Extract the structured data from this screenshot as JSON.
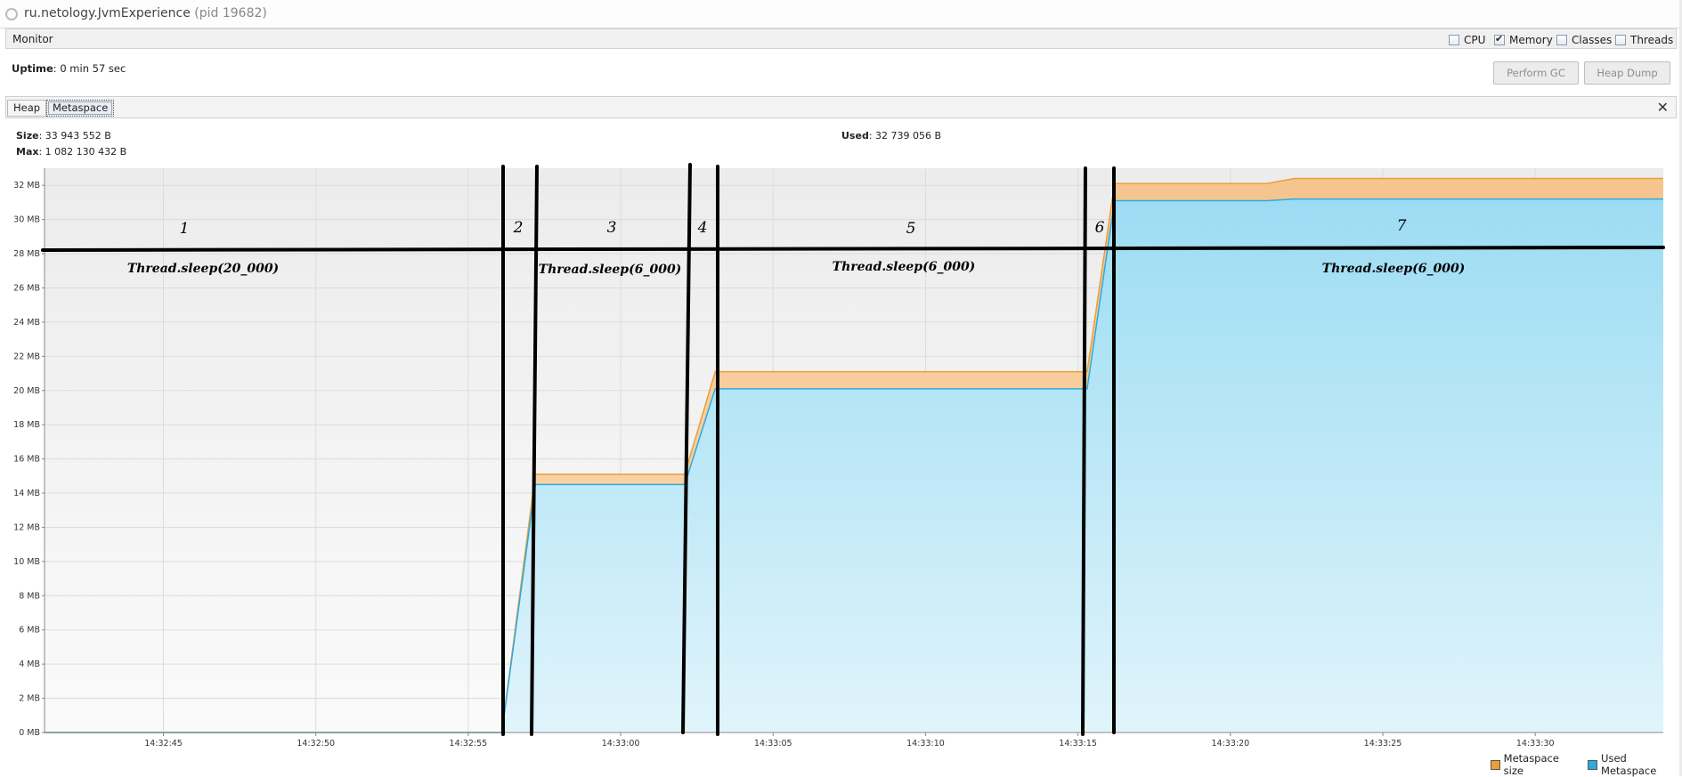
{
  "window": {
    "title": "ru.netology.JvmExperience",
    "pid": "(pid 19682)"
  },
  "monitor": {
    "label": "Monitor",
    "checkboxes": [
      {
        "label": "CPU",
        "checked": false
      },
      {
        "label": "Memory",
        "checked": true
      },
      {
        "label": "Classes",
        "checked": false
      },
      {
        "label": "Threads",
        "checked": false
      }
    ]
  },
  "uptime": {
    "label": "Uptime",
    "value": ": 0 min 57 sec"
  },
  "buttons": {
    "perform_gc": "Perform GC",
    "heap_dump": "Heap Dump"
  },
  "tabs": {
    "heap": "Heap",
    "metaspace": "Metaspace",
    "close": "✕"
  },
  "stats": {
    "size_label": "Size",
    "size_value": ": 33 943 552 B",
    "max_label": "Max",
    "max_value": ": 1 082 130 432 B",
    "used_label": "Used",
    "used_value": ": 32 739 056 B"
  },
  "colors": {
    "metaspace_size": "#e8a03a",
    "used_metaspace": "#2eaadc",
    "plot_bg": "#f3f3f3",
    "annotation": "#000000"
  },
  "chart_data": {
    "type": "area",
    "unit": "MB",
    "ylim": [
      0,
      33
    ],
    "y_ticks": [
      0,
      2,
      4,
      6,
      8,
      10,
      12,
      14,
      16,
      18,
      20,
      22,
      24,
      26,
      28,
      30,
      32
    ],
    "y_tick_labels": [
      "0 MB",
      "2 MB",
      "4 MB",
      "6 MB",
      "8 MB",
      "10 MB",
      "12 MB",
      "14 MB",
      "16 MB",
      "18 MB",
      "20 MB",
      "22 MB",
      "24 MB",
      "26 MB",
      "28 MB",
      "30 MB",
      "32 MB"
    ],
    "xlim": [
      "14:32:41.1",
      "14:33:34.2"
    ],
    "x_ticks": [
      "14:32:45",
      "14:32:50",
      "14:32:55",
      "14:33:00",
      "14:33:05",
      "14:33:10",
      "14:33:15",
      "14:33:20",
      "14:33:25",
      "14:33:30"
    ],
    "grid": true,
    "legend_position": "bottom-right",
    "series": [
      {
        "name": "Metaspace size",
        "x": [
          "14:32:41.1",
          "14:32:56.1",
          "14:32:57.2",
          "14:33:02.1",
          "14:33:03.1",
          "14:33:15.3",
          "14:33:16.2",
          "14:33:21.2",
          "14:33:22.1",
          "14:33:34.2"
        ],
        "values": [
          0,
          0,
          15.1,
          15.1,
          21.1,
          21.1,
          32.1,
          32.1,
          32.4,
          32.4
        ]
      },
      {
        "name": "Used Metaspace",
        "x": [
          "14:32:41.1",
          "14:32:56.1",
          "14:32:57.2",
          "14:33:02.1",
          "14:33:03.1",
          "14:33:15.3",
          "14:33:16.2",
          "14:33:21.2",
          "14:33:22.1",
          "14:33:34.2"
        ],
        "values": [
          0,
          0,
          14.5,
          14.5,
          20.1,
          20.1,
          31.1,
          31.1,
          31.2,
          31.2
        ]
      }
    ],
    "annotations": {
      "phase_numbers": [
        "1",
        "2",
        "3",
        "4",
        "5",
        "6",
        "7"
      ],
      "sleep_labels": [
        "Thread.sleep(20_000)",
        "Thread.sleep(6_000)",
        "Thread.sleep(6_000)",
        "Thread.sleep(6_000)"
      ]
    }
  }
}
